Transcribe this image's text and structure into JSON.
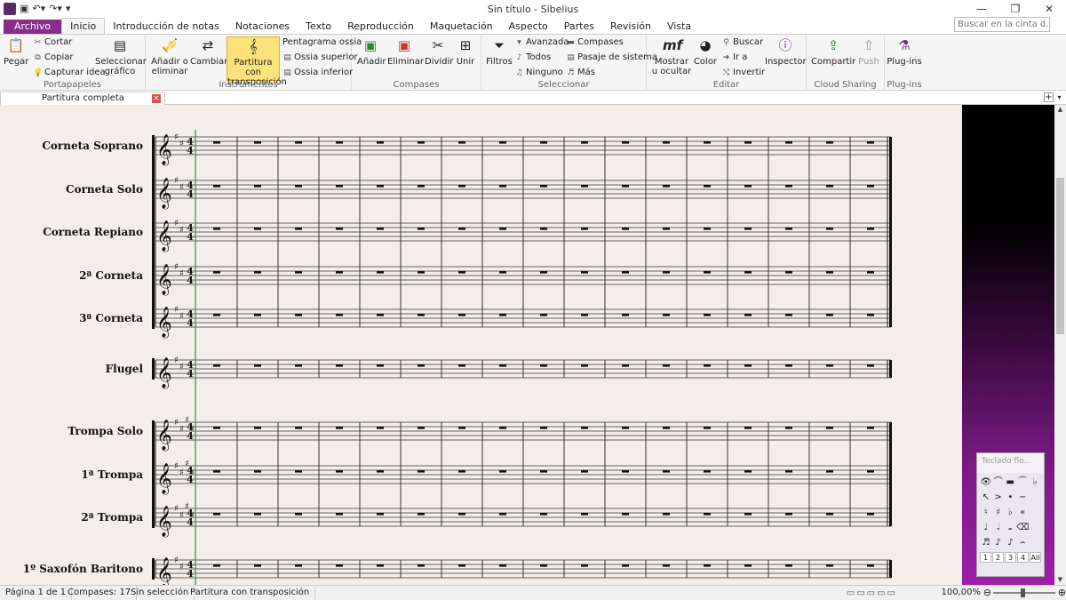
{
  "window": {
    "title": "Sin título - Sibelius",
    "app_logo": "S",
    "controls": [
      "minimize-icon",
      "maximize-icon",
      "close-icon"
    ]
  },
  "ribbon_tabs": [
    {
      "label": "Archivo",
      "style": "file"
    },
    {
      "label": "Inicio",
      "active": true
    },
    {
      "label": "Introducción de notas"
    },
    {
      "label": "Notaciones"
    },
    {
      "label": "Texto"
    },
    {
      "label": "Reproducción"
    },
    {
      "label": "Maquetación"
    },
    {
      "label": "Aspecto"
    },
    {
      "label": "Partes"
    },
    {
      "label": "Revisión"
    },
    {
      "label": "Vista"
    }
  ],
  "search_placeholder": "Buscar en la cinta d...",
  "groups": {
    "portapapeles": {
      "label": "Portapapeles",
      "pegar": "Pegar",
      "cortar": "Cortar",
      "copiar": "Copiar",
      "capturar": "Capturar idea",
      "seleccionar": "Seleccionar gráfico"
    },
    "instrumentos": {
      "label": "Instrumentos",
      "anadir": "Añadir o eliminar",
      "cambiar": "Cambiar",
      "partitura": "Partitura con transposición",
      "ossia": "Pentagrama ossia",
      "ossia_sup": "Ossia superior",
      "ossia_inf": "Ossia inferior"
    },
    "compases": {
      "label": "Compases",
      "anadir": "Añadir",
      "eliminar": "Eliminar",
      "dividir": "Dividir",
      "unir": "Unir"
    },
    "seleccionar": {
      "label": "Seleccionar",
      "filtros": "Filtros",
      "avanzada": "Avanzada",
      "todos": "Todos",
      "ninguno": "Ninguno",
      "compases": "Compases",
      "pasaje": "Pasaje de sistema",
      "mas": "Más"
    },
    "editar": {
      "label": "Editar",
      "mostrar": "Mostrar u ocultar",
      "color": "Color",
      "buscar": "Buscar",
      "ir_a": "Ir a",
      "invertir": "Invertir",
      "inspector": "Inspector"
    },
    "cloud": {
      "label": "Cloud Sharing",
      "compartir": "Compartir",
      "push": "Push"
    },
    "plugins": {
      "label": "Plug-ins",
      "plugins": "Plug-ins"
    }
  },
  "document_tab": "Partitura completa",
  "score": {
    "time_signature": "4/4",
    "measures": 17,
    "staves": [
      {
        "name": "Corneta Soprano"
      },
      {
        "name": "Corneta Solo"
      },
      {
        "name": "Corneta Repiano"
      },
      {
        "name": "2ª Corneta"
      },
      {
        "name": "3ª Corneta"
      },
      {
        "name": "Flugel"
      },
      {
        "name": "Trompa Solo"
      },
      {
        "name": "1ª Trompa"
      },
      {
        "name": "2ª Trompa"
      },
      {
        "name": "1º Saxofón Baritono"
      }
    ]
  },
  "keypad": {
    "title": "Teclado flo...",
    "layout_tabs": [
      "1",
      "2",
      "3",
      "4",
      "All"
    ]
  },
  "status": {
    "page": "Página 1 de 1",
    "bars": "Compases: 17",
    "selection": "Sin selección",
    "mode": "Partitura con transposición",
    "zoom": "100,00%"
  }
}
